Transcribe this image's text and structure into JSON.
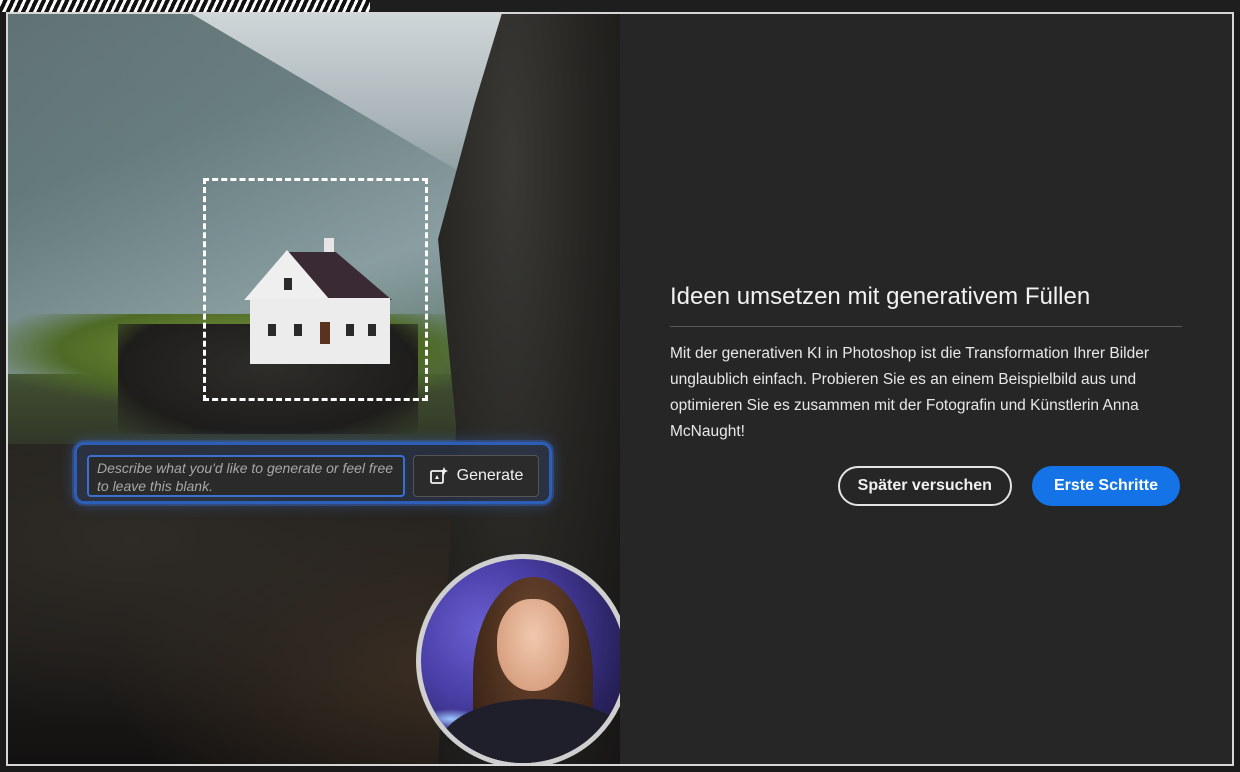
{
  "dialog": {
    "prompt": {
      "placeholder": "Describe what you'd like to generate or feel free to leave this blank.",
      "generate_label": "Generate"
    },
    "title": "Ideen umsetzen mit generativem Füllen",
    "description": "Mit der generativen KI in Photoshop ist die Transformation Ihrer Bilder unglaublich einfach. Probieren Sie es an einem Beispielbild aus und optimieren Sie es zusammen mit der Fotografin und Künstlerin Anna McNaught!",
    "buttons": {
      "later_label": "Später versuchen",
      "start_label": "Erste Schritte"
    },
    "colors": {
      "primary_button": "#1473e6",
      "panel_background": "#262626",
      "prompt_highlight": "#2d5fb8"
    },
    "icons": {
      "generate": "generative-fill-icon"
    }
  }
}
